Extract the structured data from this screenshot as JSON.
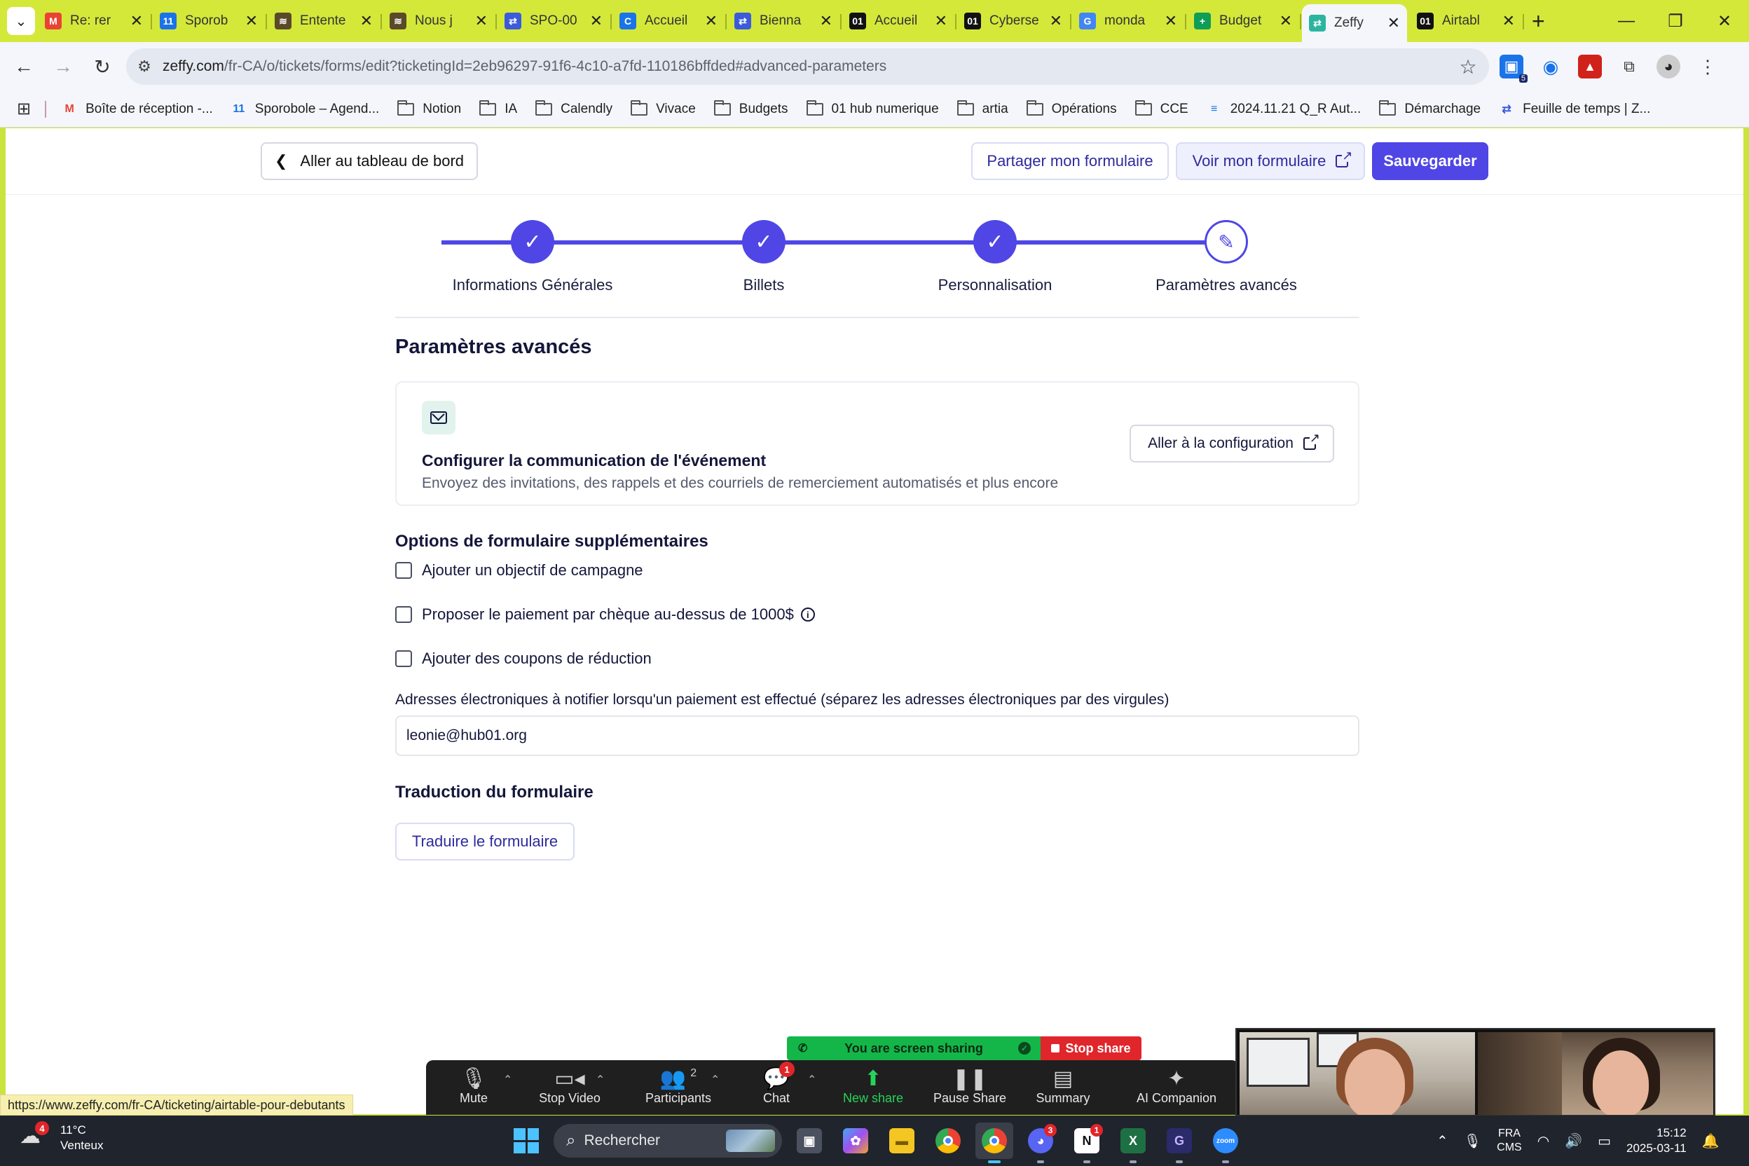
{
  "tabs": [
    {
      "title": "Re: rer",
      "icon": "gmail-icon",
      "color": "#ea4335",
      "glyph": "M",
      "active": false
    },
    {
      "title": "Sporob",
      "icon": "calendar-icon",
      "color": "#1a73e8",
      "glyph": "11",
      "active": false
    },
    {
      "title": "Entente",
      "icon": "hat-icon",
      "color": "#5a4a2a",
      "glyph": "≋",
      "active": false
    },
    {
      "title": "Nous j",
      "icon": "hat-icon",
      "color": "#5a4a2a",
      "glyph": "≋",
      "active": false
    },
    {
      "title": "SPO-00",
      "icon": "zeffy-icon",
      "color": "#3b5bdb",
      "glyph": "⇄",
      "active": false
    },
    {
      "title": "Accueil",
      "icon": "c-icon",
      "color": "#1a73e8",
      "glyph": "C",
      "active": false
    },
    {
      "title": "Bienna",
      "icon": "zeffy-icon",
      "color": "#3b5bdb",
      "glyph": "⇄",
      "active": false
    },
    {
      "title": "Accueil",
      "icon": "o1-icon",
      "color": "#111111",
      "glyph": "01",
      "active": false
    },
    {
      "title": "Cyberse",
      "icon": "o1-icon",
      "color": "#111111",
      "glyph": "01",
      "active": false
    },
    {
      "title": "monda",
      "icon": "google-icon",
      "color": "#4285f4",
      "glyph": "G",
      "active": false
    },
    {
      "title": "Budget",
      "icon": "sheets-icon",
      "color": "#0f9d58",
      "glyph": "+",
      "active": false
    },
    {
      "title": "Zeffy",
      "icon": "zeffy-icon",
      "color": "#2bb5a0",
      "glyph": "⇄",
      "active": true
    },
    {
      "title": "Airtabl",
      "icon": "o1-icon",
      "color": "#111111",
      "glyph": "01",
      "active": false
    }
  ],
  "address": {
    "domain": "zeffy.com",
    "path": "/fr-CA/o/tickets/forms/edit?ticketingId=2eb96297-91f6-4c10-a7fd-110186bffded#advanced-parameters"
  },
  "extensions_badge": "5",
  "bookmarks": [
    {
      "label": "Boîte de réception -...",
      "kind": "gmail"
    },
    {
      "label": "Sporobole – Agend...",
      "kind": "calendar"
    },
    {
      "label": "Notion",
      "kind": "folder"
    },
    {
      "label": "IA",
      "kind": "folder"
    },
    {
      "label": "Calendly",
      "kind": "folder"
    },
    {
      "label": "Vivace",
      "kind": "folder"
    },
    {
      "label": "Budgets",
      "kind": "folder"
    },
    {
      "label": "01 hub numerique",
      "kind": "folder"
    },
    {
      "label": "artia",
      "kind": "folder"
    },
    {
      "label": "Opérations",
      "kind": "folder"
    },
    {
      "label": "CCE",
      "kind": "folder"
    },
    {
      "label": "2024.11.21 Q_R Aut...",
      "kind": "doc"
    },
    {
      "label": "Démarchage",
      "kind": "folder"
    },
    {
      "label": "Feuille de temps | Z...",
      "kind": "zeffy"
    }
  ],
  "page": {
    "back_label": "Aller au tableau de bord",
    "share_label": "Partager mon formulaire",
    "view_label": "Voir mon formulaire",
    "save_label": "Sauvegarder",
    "steps": [
      {
        "label": "Informations Générales",
        "done": true
      },
      {
        "label": "Billets",
        "done": true
      },
      {
        "label": "Personnalisation",
        "done": true
      },
      {
        "label": "Paramètres avancés",
        "done": false
      }
    ],
    "title": "Paramètres avancés",
    "comm_card": {
      "title": "Configurer la communication de l'événement",
      "subtitle": "Envoyez des invitations, des rappels et des courriels de remerciement automatisés et plus encore",
      "button": "Aller à la configuration"
    },
    "options_title": "Options de formulaire supplémentaires",
    "options": [
      {
        "label": "Ajouter un objectif de campagne",
        "checked": false,
        "info": false
      },
      {
        "label": "Proposer le paiement par chèque au-dessus de 1000$",
        "checked": false,
        "info": true
      },
      {
        "label": "Ajouter des coupons de réduction",
        "checked": false,
        "info": false
      }
    ],
    "email_label": "Adresses électroniques à notifier lorsqu'un paiement est effectué (séparez les adresses électroniques par des virgules)",
    "email_value": "leonie@hub01.org",
    "translation_title": "Traduction du formulaire",
    "translate_button": "Traduire le formulaire"
  },
  "status_url": "https://www.zeffy.com/fr-CA/ticketing/airtable-pour-debutants",
  "zoom": {
    "sharing_text": "You are screen sharing",
    "stop_share": "Stop share",
    "items": [
      {
        "label": "Mute",
        "icon": "microphone-icon"
      },
      {
        "label": "Stop Video",
        "icon": "video-camera-icon"
      },
      {
        "label": "Participants",
        "icon": "participants-icon",
        "count": "2"
      },
      {
        "label": "Chat",
        "icon": "chat-icon",
        "badge": "1"
      },
      {
        "label": "New share",
        "icon": "share-arrow-icon"
      },
      {
        "label": "Pause Share",
        "icon": "pause-icon"
      },
      {
        "label": "Summary",
        "icon": "summary-icon"
      },
      {
        "label": "AI Companion",
        "icon": "sparkle-icon"
      }
    ]
  },
  "taskbar": {
    "weather_temp": "11°C",
    "weather_desc": "Venteux",
    "weather_badge": "4",
    "search_placeholder": "Rechercher",
    "discord_badge": "3",
    "notion_badge": "1",
    "lang_top": "FRA",
    "lang_bottom": "CMS",
    "time": "15:12",
    "date": "2025-03-11"
  },
  "colors": {
    "accent": "#4f46e5",
    "tabbar": "#d4e83a",
    "zoom_green": "#14b64a",
    "zoom_red": "#e0262b"
  }
}
